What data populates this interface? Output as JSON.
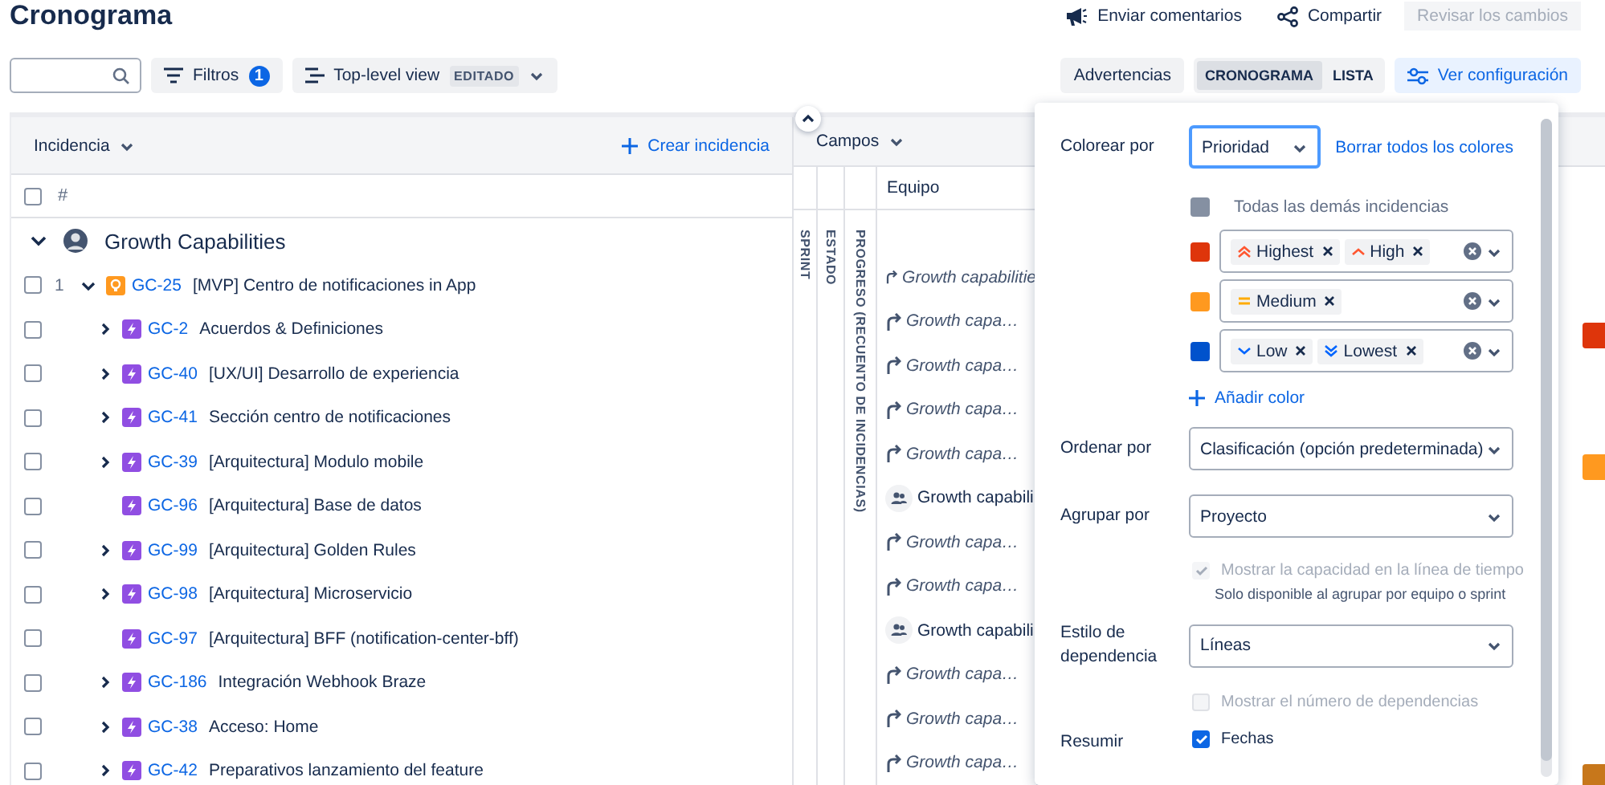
{
  "page": {
    "title": "Cronograma"
  },
  "header_actions": [
    {
      "kind": "feedback",
      "label": "Enviar comentarios",
      "disabled": false
    },
    {
      "kind": "share",
      "label": "Compartir",
      "disabled": false
    },
    {
      "kind": "plain",
      "label": "Revisar los cambios",
      "disabled": true
    }
  ],
  "toolbar": {
    "filters": {
      "label": "Filtros",
      "count": "1"
    },
    "view": {
      "label": "Top-level view",
      "badge": "EDITADO"
    },
    "warnings": "Advertencias",
    "view_modes": [
      {
        "label": "CRONOGRAMA",
        "selected": true
      },
      {
        "label": "LISTA",
        "selected": false
      }
    ],
    "settings_button": "Ver configuración"
  },
  "table": {
    "select_all_checked": false,
    "issue_header": "Incidencia",
    "create_link": "Crear incidencia",
    "fields_header": "Campos",
    "number_header": "#",
    "team_header": "Equipo",
    "field_columns": [
      "SPRINT",
      "ESTADO",
      "PROGRESO (RECUENTO DE INCIDENCIAS)"
    ],
    "group": {
      "name": "Growth Capabilities",
      "expanded": true
    },
    "rows": [
      {
        "number": "1",
        "kind": "initiative",
        "key": "GC-25",
        "summary": "[MVP] Centro de notificaciones in App",
        "checked": false,
        "expanded": true,
        "team": {
          "kind": "inherited",
          "name": "Growth capabilitie"
        },
        "children": [
          {
            "kind": "epic",
            "key": "GC-2",
            "summary": "Acuerdos & Definiciones",
            "checked": false,
            "expanded": false,
            "team": {
              "kind": "inherited",
              "name": "Growth capa…"
            }
          },
          {
            "kind": "epic",
            "key": "GC-40",
            "summary": "[UX/UI] Desarrollo de experiencia",
            "checked": false,
            "expanded": false,
            "team": {
              "kind": "inherited",
              "name": "Growth capa…"
            }
          },
          {
            "kind": "epic",
            "key": "GC-41",
            "summary": "Sección centro de notificaciones",
            "checked": false,
            "expanded": false,
            "team": {
              "kind": "inherited",
              "name": "Growth capa…"
            }
          },
          {
            "kind": "epic",
            "key": "GC-39",
            "summary": "[Arquitectura] Modulo mobile",
            "checked": false,
            "expanded": false,
            "team": {
              "kind": "inherited",
              "name": "Growth capa…"
            }
          },
          {
            "kind": "epic",
            "key": "GC-96",
            "summary": "[Arquitectura] Base de datos",
            "checked": false,
            "team": {
              "kind": "assigned",
              "name": "Growth capabili"
            }
          },
          {
            "kind": "epic",
            "key": "GC-99",
            "summary": "[Arquitectura] Golden Rules",
            "checked": false,
            "expanded": false,
            "team": {
              "kind": "inherited",
              "name": "Growth capa…"
            }
          },
          {
            "kind": "epic",
            "key": "GC-98",
            "summary": "[Arquitectura] Microservicio",
            "checked": false,
            "expanded": false,
            "team": {
              "kind": "inherited",
              "name": "Growth capa…"
            }
          },
          {
            "kind": "epic",
            "key": "GC-97",
            "summary": "[Arquitectura] BFF (notification-center-bff)",
            "checked": false,
            "team": {
              "kind": "assigned",
              "name": "Growth capabili"
            }
          },
          {
            "kind": "epic",
            "key": "GC-186",
            "summary": "Integración Webhook Braze",
            "checked": false,
            "expanded": false,
            "team": {
              "kind": "inherited",
              "name": "Growth capa…"
            }
          },
          {
            "kind": "epic",
            "key": "GC-38",
            "summary": "Acceso: Home",
            "checked": false,
            "expanded": false,
            "team": {
              "kind": "inherited",
              "name": "Growth capa…"
            }
          },
          {
            "kind": "epic",
            "key": "GC-42",
            "summary": "Preparativos lanzamiento del feature",
            "checked": false,
            "expanded": false,
            "team": {
              "kind": "inherited",
              "name": "Growth capa…"
            }
          }
        ]
      }
    ]
  },
  "settings_panel": {
    "color_by": {
      "label": "Colorear por",
      "value": "Prioridad",
      "clear": "Borrar todos los colores"
    },
    "color_rules": [
      {
        "kind": "other",
        "color": "#8590a2",
        "label": "Todas las demás incidencias"
      },
      {
        "kind": "rule",
        "color": "#de350b",
        "chips": [
          {
            "kind": "highest",
            "label": "Highest"
          },
          {
            "kind": "high",
            "label": "High"
          }
        ]
      },
      {
        "kind": "rule",
        "color": "#ff991f",
        "chips": [
          {
            "kind": "medium",
            "label": "Medium"
          }
        ]
      },
      {
        "kind": "rule",
        "color": "#0052cc",
        "chips": [
          {
            "kind": "low",
            "label": "Low"
          },
          {
            "kind": "lowest",
            "label": "Lowest"
          }
        ]
      }
    ],
    "add_color": "Añadir color",
    "options": [
      {
        "kind": "select",
        "label": "Ordenar por",
        "value": "Clasificación (opción predeterminada)"
      },
      {
        "kind": "select",
        "label": "Agrupar por",
        "value": "Proyecto"
      },
      {
        "kind": "checkbox",
        "label": "Mostrar la capacidad en la línea de tiempo",
        "checked": true,
        "disabled": true,
        "note": "Solo disponible al agrupar por equipo o sprint"
      },
      {
        "kind": "select",
        "label": "Estilo de dependencia",
        "value": "Líneas"
      },
      {
        "kind": "checkbox",
        "label": "Mostrar el número de dependencias",
        "checked": false,
        "disabled": true
      },
      {
        "kind": "checkbox",
        "section": "Resumir",
        "label": "Fechas",
        "checked": true,
        "disabled": false
      }
    ]
  }
}
